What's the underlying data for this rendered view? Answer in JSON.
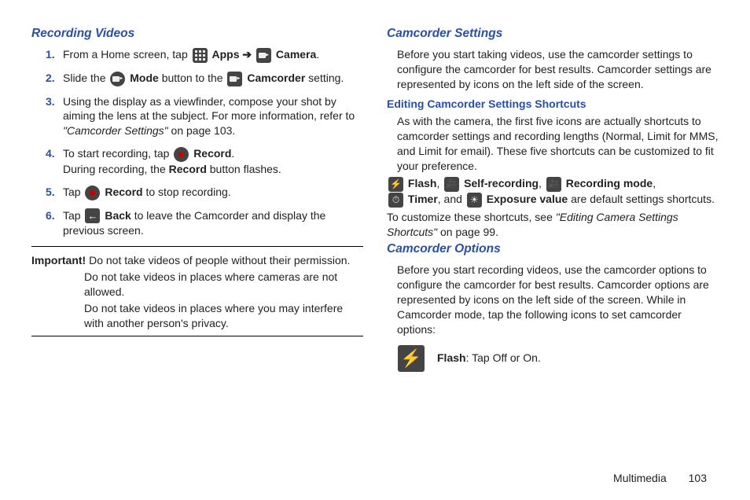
{
  "left": {
    "heading": "Recording Videos",
    "steps": [
      {
        "num": "1.",
        "pre": "From a Home screen, tap ",
        "b1": "Apps",
        "arrow": " ➔ ",
        "b2": "Camera",
        "post": "."
      },
      {
        "num": "2.",
        "pre": "Slide the ",
        "b1": "Mode",
        "mid": " button to the ",
        "b2": "Camcorder",
        "post": " setting."
      },
      {
        "num": "3.",
        "pre": "Using the display as a viewfinder, compose your shot by aiming the lens at the subject. For more information, refer to ",
        "ref": "\"Camcorder Settings\"",
        "post": "  on page 103."
      },
      {
        "num": "4.",
        "pre": "To start recording, tap ",
        "b1": "Record",
        "post": ".",
        "line2a": "During recording, the ",
        "line2b": "Record",
        "line2c": " button flashes."
      },
      {
        "num": "5.",
        "pre": "Tap ",
        "b1": "Record",
        "post": " to stop recording."
      },
      {
        "num": "6.",
        "pre": "Tap ",
        "b1": "Back",
        "post": " to leave the Camcorder and display the previous screen."
      }
    ],
    "important_label": "Important!",
    "important1": "Do not take videos of people without their permission.",
    "important2": "Do not take videos in places where cameras are not allowed.",
    "important3": "Do not take videos in places where you may interfere with another person's privacy."
  },
  "right": {
    "heading1": "Camcorder Settings",
    "p1": "Before you start taking videos, use the camcorder settings to configure the camcorder for best results. Camcorder settings are represented by icons on the left side of the screen.",
    "subheading": "Editing Camcorder Settings Shortcuts",
    "p2": "As with the camera, the first five icons are actually shortcuts to camcorder settings and recording lengths (Normal, Limit for MMS, and Limit for email). These five shortcuts can be customized to fit your preference.",
    "shortcut_flash": "Flash",
    "shortcut_self": "Self-recording",
    "shortcut_recmode": "Recording mode",
    "shortcut_timer": "Timer",
    "shortcut_and": ", and ",
    "shortcut_exposure": "Exposure value",
    "shortcut_tail": " are default settings shortcuts.",
    "p3_pre": "To customize these shortcuts, see ",
    "p3_ref": "\"Editing Camera Settings Shortcuts\"",
    "p3_post": " on page 99.",
    "heading2": "Camcorder Options",
    "p4": "Before you start recording videos, use the camcorder options to configure the camcorder for best results. Camcorder options are represented by icons on the left side of the screen. While in Camcorder mode, tap the following icons to set camcorder options:",
    "flash_label": "Flash",
    "flash_text": ": Tap Off or On."
  },
  "footer": {
    "section": "Multimedia",
    "page": "103"
  }
}
